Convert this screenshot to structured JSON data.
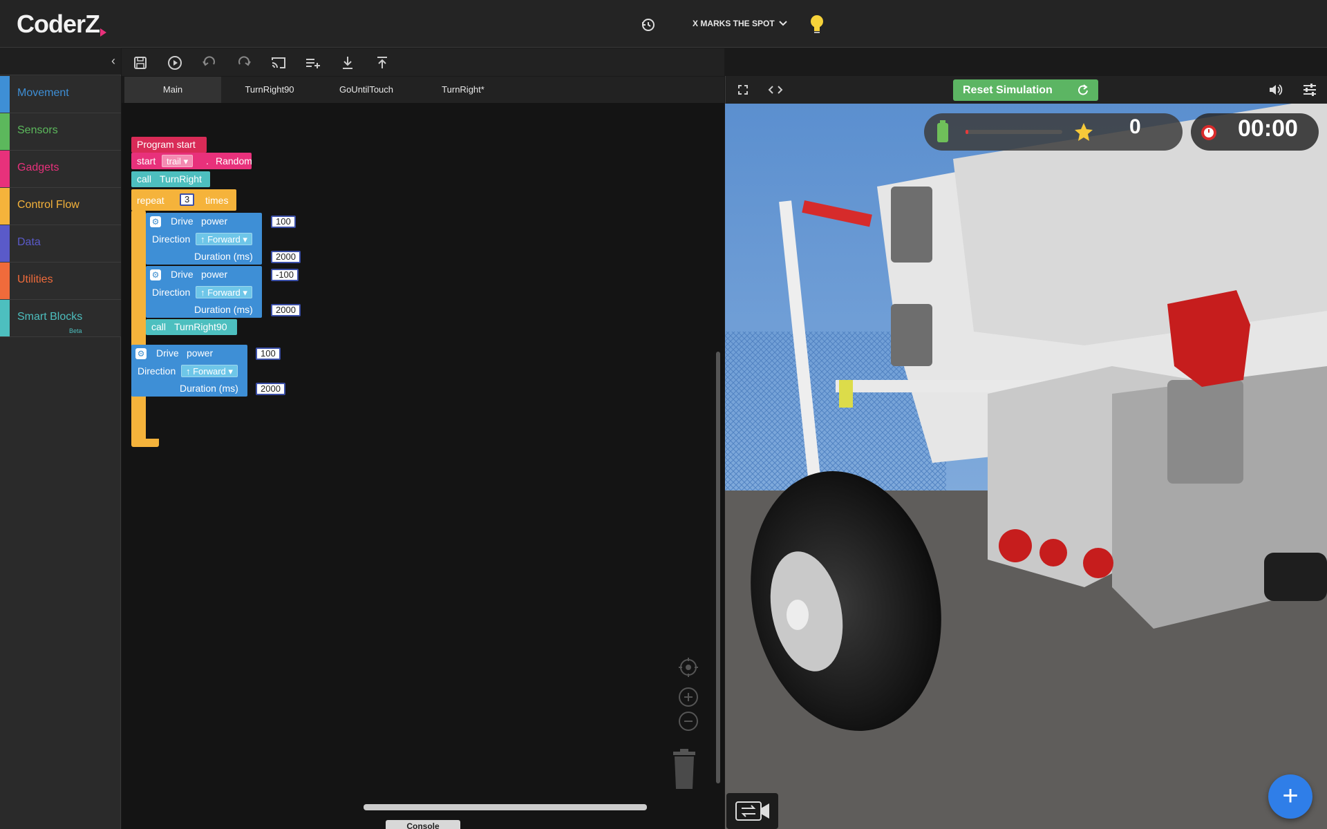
{
  "app": {
    "logo": "CoderZ"
  },
  "header": {
    "mission": "X MARKS THE SPOT"
  },
  "sidebar": {
    "categories": [
      {
        "label": "Movement",
        "color": "#3e8fd6"
      },
      {
        "label": "Sensors",
        "color": "#5cb85c"
      },
      {
        "label": "Gadgets",
        "color": "#e8317b"
      },
      {
        "label": "Control Flow",
        "color": "#f5b33b"
      },
      {
        "label": "Data",
        "color": "#5a5ac9"
      },
      {
        "label": "Utilities",
        "color": "#f06b3b"
      },
      {
        "label": "Smart Blocks",
        "color": "#4dbfbf",
        "badge": "Beta"
      }
    ]
  },
  "toolbar": {
    "icons": [
      "save-icon",
      "play-icon",
      "undo-icon",
      "redo-icon",
      "cast-icon",
      "add-list-icon",
      "download-icon",
      "upload-icon"
    ]
  },
  "tabs": [
    "Main",
    "TurnRight90",
    "GoUntilTouch",
    "TurnRight*"
  ],
  "active_tab": "Main",
  "blocks": {
    "program_start": "Program start",
    "start": {
      "kw": "start",
      "dropdown": "trail",
      "dot": ".",
      "mode": "Random"
    },
    "call1": {
      "kw": "call",
      "name": "TurnRight"
    },
    "repeat": {
      "kw": "repeat",
      "count": "3",
      "suffix": "times"
    },
    "drive1": {
      "label": "Drive",
      "power_label": "power",
      "power": "100",
      "dir_label": "Direction",
      "direction": "↑ Forward",
      "dur_label": "Duration (ms)",
      "duration": "2000"
    },
    "drive2": {
      "label": "Drive",
      "power_label": "power",
      "power": "-100",
      "dir_label": "Direction",
      "direction": "↑ Forward",
      "dur_label": "Duration (ms)",
      "duration": "2000"
    },
    "call2": {
      "kw": "call",
      "name": "TurnRight90"
    },
    "drive3": {
      "label": "Drive",
      "power_label": "power",
      "power": "100",
      "dir_label": "Direction",
      "direction": "↑ Forward",
      "dur_label": "Duration (ms)",
      "duration": "2000"
    }
  },
  "console": {
    "label": "Console"
  },
  "simulation": {
    "reset_label": "Reset Simulation",
    "score": "0",
    "timer": "00:00",
    "battery_level": 0.02
  },
  "colors": {
    "movement": "#3e8fd6",
    "control": "#f5b33b",
    "gadget": "#e8317b",
    "call": "#4dbfbf",
    "reset": "#5cb563",
    "fab": "#2f7ee8"
  }
}
